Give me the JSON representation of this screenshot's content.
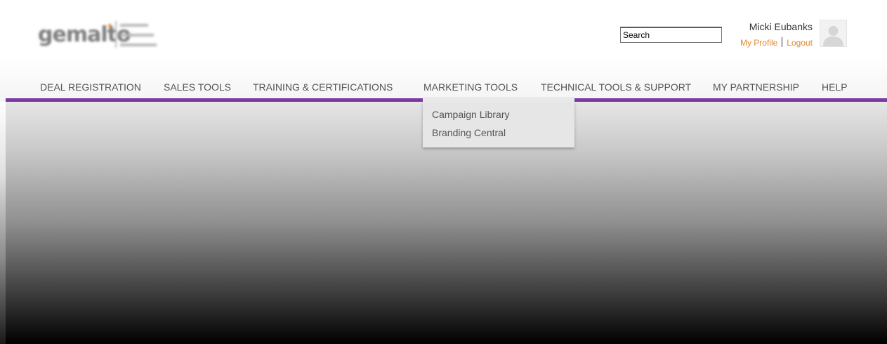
{
  "header": {
    "search": {
      "value": "Search"
    },
    "user": {
      "name": "Micki Eubanks",
      "profile_link": "My Profile",
      "logout_link": "Logout"
    }
  },
  "nav": {
    "items": [
      "DEAL REGISTRATION",
      "SALES TOOLS",
      "TRAINING & CERTIFICATIONS",
      "MARKETING TOOLS",
      "TECHNICAL TOOLS & SUPPORT",
      "MY PARTNERSHIP",
      "HELP"
    ],
    "active_dropdown": {
      "items": [
        "Campaign Library",
        "Branding Central"
      ]
    }
  },
  "colors": {
    "accent_purple": "#7b3aa2",
    "link_orange": "#e3892c"
  },
  "icons": {
    "avatar": "user-silhouette-icon"
  }
}
